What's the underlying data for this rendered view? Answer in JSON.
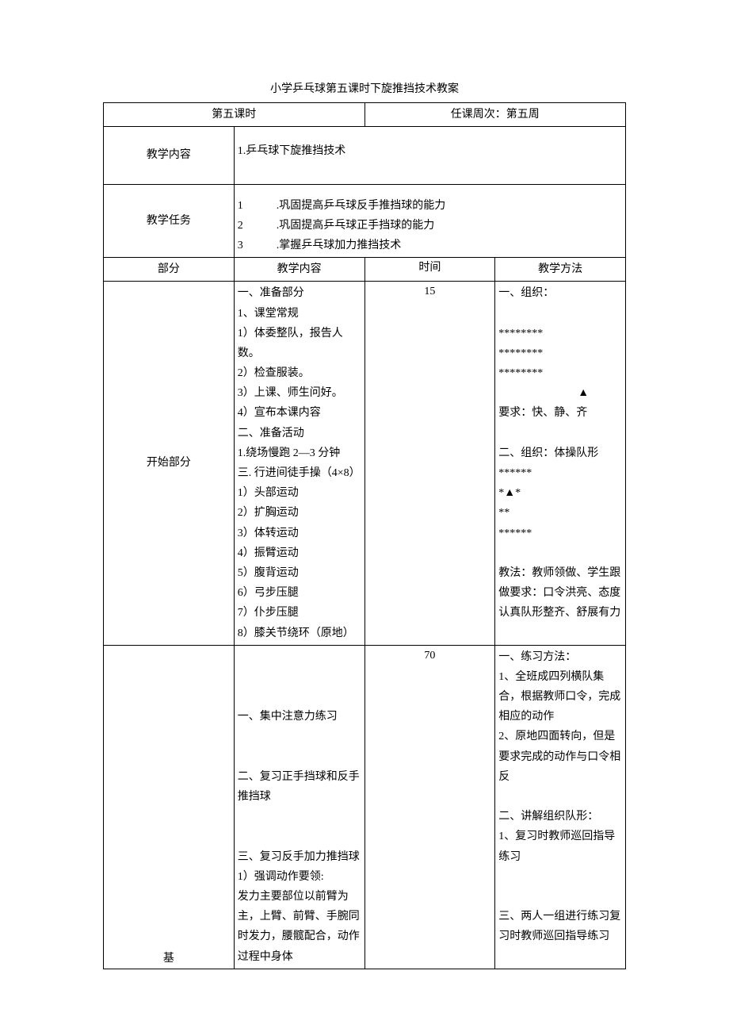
{
  "title": "小学乒乓球第五课时下旋推挡技术教案",
  "header": {
    "lesson": "第五课时",
    "week": "任课周次：第五周"
  },
  "teachContentLabel": "教学内容",
  "teachContent": "1.乒乓球下旋推挡技术",
  "teachTaskLabel": "教学任务",
  "teachTasks": {
    "t1": "1　　　.巩固提高乒乓球反手推挡球的能力",
    "t2": "2　　　.巩固提高乒乓球正手挡球的能力",
    "t3": "3　　　.掌握乒乓球加力推挡技术"
  },
  "colHeads": {
    "part": "部分",
    "content": "教学内容",
    "time": "时间",
    "method": "教学方法"
  },
  "start": {
    "label": "开始部分",
    "time": "15",
    "content": {
      "a": "一、准备部分",
      "b": "1、课堂常规",
      "c": "1）体委整队，报告人数。",
      "d": "2）检查服装。",
      "e": "3）上课、师生问好。",
      "f": "4）宣布本课内容",
      "g": "二、准备活动",
      "h": "1.绕场慢跑 2—3 分钟",
      "i": "三. 行进间徒手操（4×8）",
      "j": "1）头部运动",
      "k": "2）扩胸运动",
      "l": "3）体转运动",
      "m": "4）振臂运动",
      "n": "5）腹背运动",
      "o": "6）弓步压腿",
      "p": "7）仆步压腿",
      "q": "8）膝关节绕环（原地）"
    },
    "method": {
      "a": "一、组织：",
      "f1": "********",
      "f2": "********",
      "f3": "********",
      "f4": "▲",
      "b": "要求：快、静、齐",
      "c": "二、组织：体操队形",
      "g1": "******",
      "g2": "*▲*",
      "g3": "**",
      "g4": "******",
      "d": "教法：教师领做、学生跟做要求：口令洪亮、态度认真队形整齐、舒展有力"
    }
  },
  "basic": {
    "label": "基",
    "time": "70",
    "content": {
      "a": "一、集中注意力练习",
      "b": "二、复习正手挡球和反手推挡球",
      "c": "三、复习反手加力推挡球",
      "d": "1）强调动作要领:",
      "e": "发力主要部位以前臂为主，上臂、前臂、手腕同时发力，腰髋配合，动作过程中身体"
    },
    "method": {
      "a": "一、练习方法：",
      "b": "1、全班成四列横队集合，根据教师口令，完成相应的动作",
      "c": "2、原地四面转向，但是要求完成的动作与口令相反",
      "d": "二、讲解组织队形：",
      "e": "1、复习时教师巡回指导练习",
      "f": "三、两人一组进行练习复习时教师巡回指导练习"
    }
  }
}
